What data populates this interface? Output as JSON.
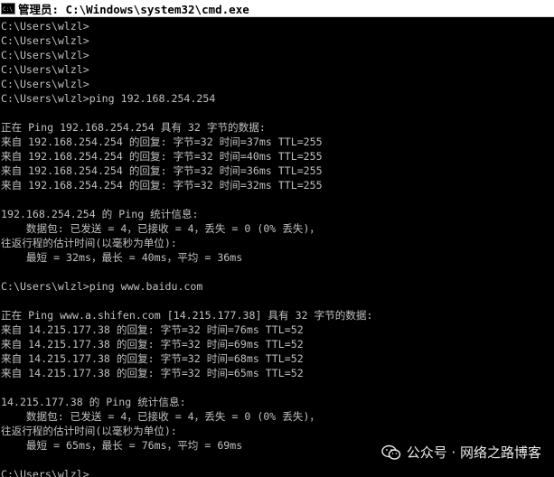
{
  "window": {
    "title": "管理员: C:\\Windows\\system32\\cmd.exe",
    "icon": "cmd-icon"
  },
  "console": {
    "lines": [
      "C:\\Users\\wlzl>",
      "C:\\Users\\wlzl>",
      "C:\\Users\\wlzl>",
      "C:\\Users\\wlzl>",
      "C:\\Users\\wlzl>",
      "C:\\Users\\wlzl>ping 192.168.254.254",
      "",
      "正在 Ping 192.168.254.254 具有 32 字节的数据:",
      "来自 192.168.254.254 的回复: 字节=32 时间=37ms TTL=255",
      "来自 192.168.254.254 的回复: 字节=32 时间=40ms TTL=255",
      "来自 192.168.254.254 的回复: 字节=32 时间=36ms TTL=255",
      "来自 192.168.254.254 的回复: 字节=32 时间=32ms TTL=255",
      "",
      "192.168.254.254 的 Ping 统计信息:",
      "    数据包: 已发送 = 4，已接收 = 4，丢失 = 0 (0% 丢失)，",
      "往返行程的估计时间(以毫秒为单位):",
      "    最短 = 32ms，最长 = 40ms，平均 = 36ms",
      "",
      "C:\\Users\\wlzl>ping www.baidu.com",
      "",
      "正在 Ping www.a.shifen.com [14.215.177.38] 具有 32 字节的数据:",
      "来自 14.215.177.38 的回复: 字节=32 时间=76ms TTL=52",
      "来自 14.215.177.38 的回复: 字节=32 时间=69ms TTL=52",
      "来自 14.215.177.38 的回复: 字节=32 时间=68ms TTL=52",
      "来自 14.215.177.38 的回复: 字节=32 时间=65ms TTL=52",
      "",
      "14.215.177.38 的 Ping 统计信息:",
      "    数据包: 已发送 = 4，已接收 = 4，丢失 = 0 (0% 丢失)，",
      "往返行程的估计时间(以毫秒为单位):",
      "    最短 = 65ms，最长 = 76ms，平均 = 69ms",
      "",
      "C:\\Users\\wlzl>"
    ]
  },
  "watermark": {
    "text": "公众号 · 网络之路博客",
    "icon": "wechat-icon"
  },
  "colors": {
    "background": "#000000",
    "text": "#c0c0c0",
    "titlebar": "#ffffff"
  }
}
